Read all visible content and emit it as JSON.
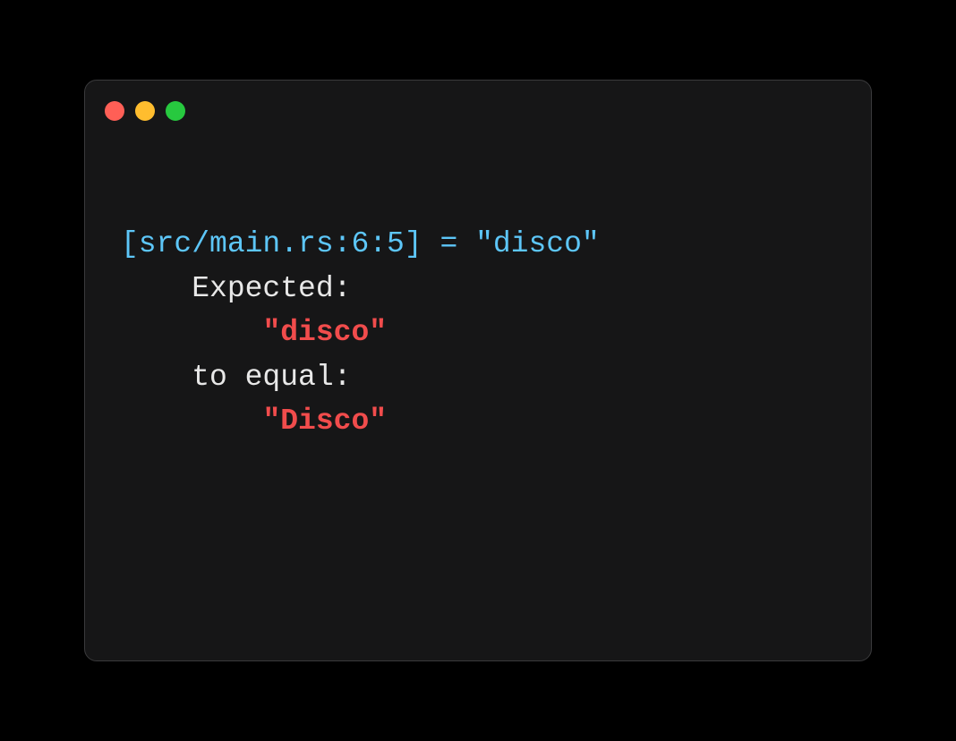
{
  "window": {
    "traffic_lights": {
      "red": "#ff5f56",
      "yellow": "#ffbd2e",
      "green": "#27c93f"
    }
  },
  "terminal": {
    "line1": "[src/main.rs:6:5] = \"disco\"",
    "line2_indent": "    ",
    "line2_text": "Expected:",
    "line3_indent": "        ",
    "line3_value": "\"disco\"",
    "line4_indent": "    ",
    "line4_text": "to equal:",
    "line5_indent": "        ",
    "line5_value": "\"Disco\""
  },
  "colors": {
    "cyan": "#5dc6f8",
    "white": "#e8e8e8",
    "red": "#f14c4c",
    "background": "#161617",
    "page_background": "#000000"
  }
}
